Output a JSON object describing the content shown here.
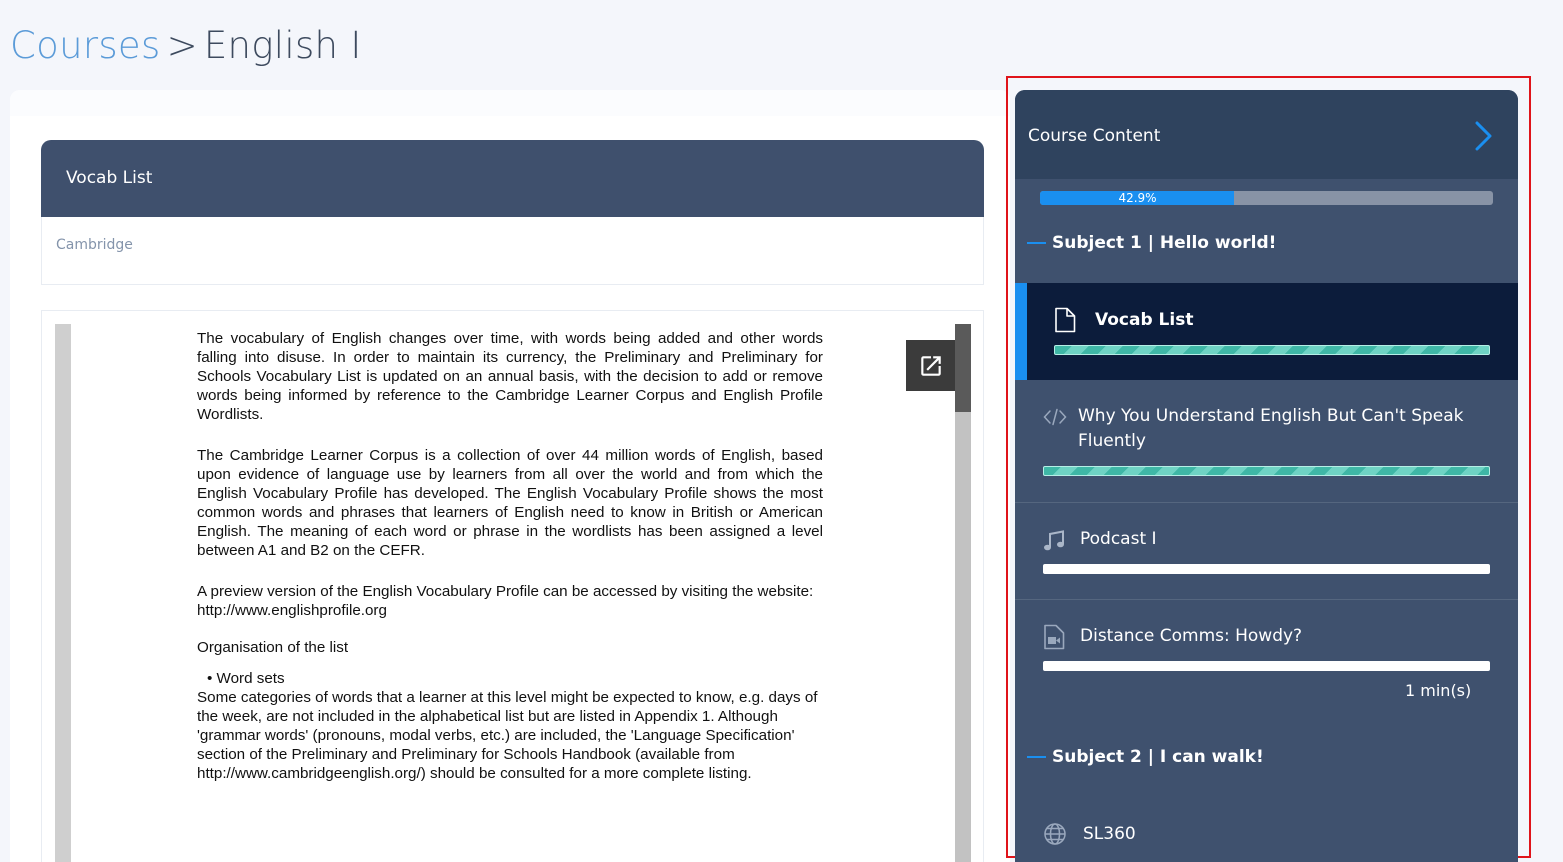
{
  "breadcrumb": {
    "root": "Courses",
    "separator": ">",
    "current": "English I"
  },
  "lesson": {
    "title": "Vocab List",
    "subtitle": "Cambridge"
  },
  "document": {
    "paragraphs": [
      "The vocabulary of English changes over time, with words being added and other words falling into disuse. In order to maintain its currency, the Preliminary and Preliminary for Schools Vocabulary List is updated on an annual basis, with the decision to add or remove words being informed by reference to the Cambridge Learner Corpus and English Profile Wordlists.",
      "The Cambridge Learner Corpus is a collection of over 44 million words of English, based upon evidence of language use by learners from all over the world and from which the English Vocabulary Profile has developed. The English Vocabulary Profile shows the most common words and phrases that learners of English need to know in British or American English. The meaning of each word or phrase in the wordlists has been assigned a level between A1 and B2 on the CEFR.",
      "A preview version of the English Vocabulary Profile can be accessed by visiting the website: http://www.englishprofile.org",
      "Organisation of the list",
      "•  Word sets",
      "Some categories of words that a learner at this level might be expected to know, e.g. days of the week, are not included in the alphabetical list but are listed in Appendix 1. Although 'grammar words' (pronouns, modal verbs, etc.) are included, the 'Language Specification' section of the Preliminary and Preliminary for Schools Handbook (available from http://www.cambridgeenglish.org/) should be consulted for a more complete listing."
    ]
  },
  "sidebar": {
    "title": "Course Content",
    "progress": {
      "percent": 42.9,
      "label": "42.9%"
    },
    "subjects": [
      {
        "title": "Subject 1 | Hello world!",
        "items": [
          {
            "label": "Vocab List",
            "icon": "document-icon",
            "active": true,
            "completed": true
          },
          {
            "label": "Why You Understand English But Can't Speak Fluently",
            "icon": "code-icon",
            "active": false,
            "completed": true
          },
          {
            "label": "Podcast I",
            "icon": "music-icon",
            "active": false,
            "completed": false
          },
          {
            "label": "Distance Comms: Howdy?",
            "icon": "video-file-icon",
            "active": false,
            "completed": false,
            "duration": "1 min(s)"
          }
        ]
      },
      {
        "title": "Subject 2 | I can walk!",
        "items": [
          {
            "label": "SL360",
            "icon": "globe-icon"
          }
        ]
      }
    ]
  },
  "colors": {
    "accent": "#1a8ff0",
    "sidebar_bg": "#3f516e",
    "sidebar_header": "#2f435e",
    "active_item": "#0c1c3b",
    "highlight_border": "#e0141a"
  }
}
